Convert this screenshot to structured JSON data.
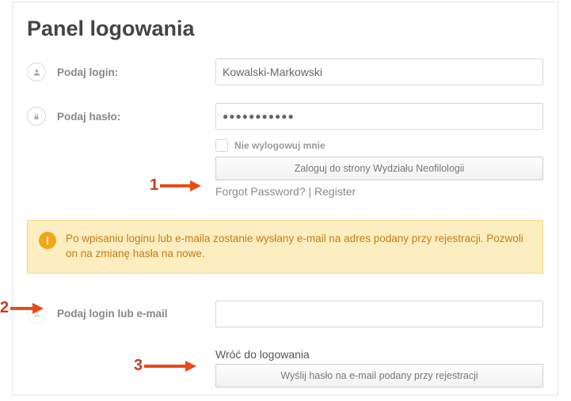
{
  "panel": {
    "title": "Panel logowania"
  },
  "login": {
    "label": "Podaj login:",
    "value": "Kowalski-Markowski"
  },
  "password": {
    "label": "Podaj hasło:",
    "value": "●●●●●●●●●●●"
  },
  "remember": {
    "label": "Nie wylogowuj mnie"
  },
  "buttons": {
    "login": "Zaloguj do strony Wydziału Neofilologii",
    "send": "Wyślij hasło na e-mail podany przy rejestracji"
  },
  "links": {
    "forgot": "Forgot Password?",
    "sep": " | ",
    "register": "Register",
    "back": "Wróć do logowania"
  },
  "alert": {
    "text": "Po wpisaniu loginu lub e-maila zostanie wysłany e-mail na adres podany przy rejestracji. Pozwoli on na zmianę hasła na nowe."
  },
  "recover": {
    "label": "Podaj login lub e-mail"
  },
  "annotations": {
    "n1": "1",
    "n2": "2",
    "n3": "3"
  }
}
